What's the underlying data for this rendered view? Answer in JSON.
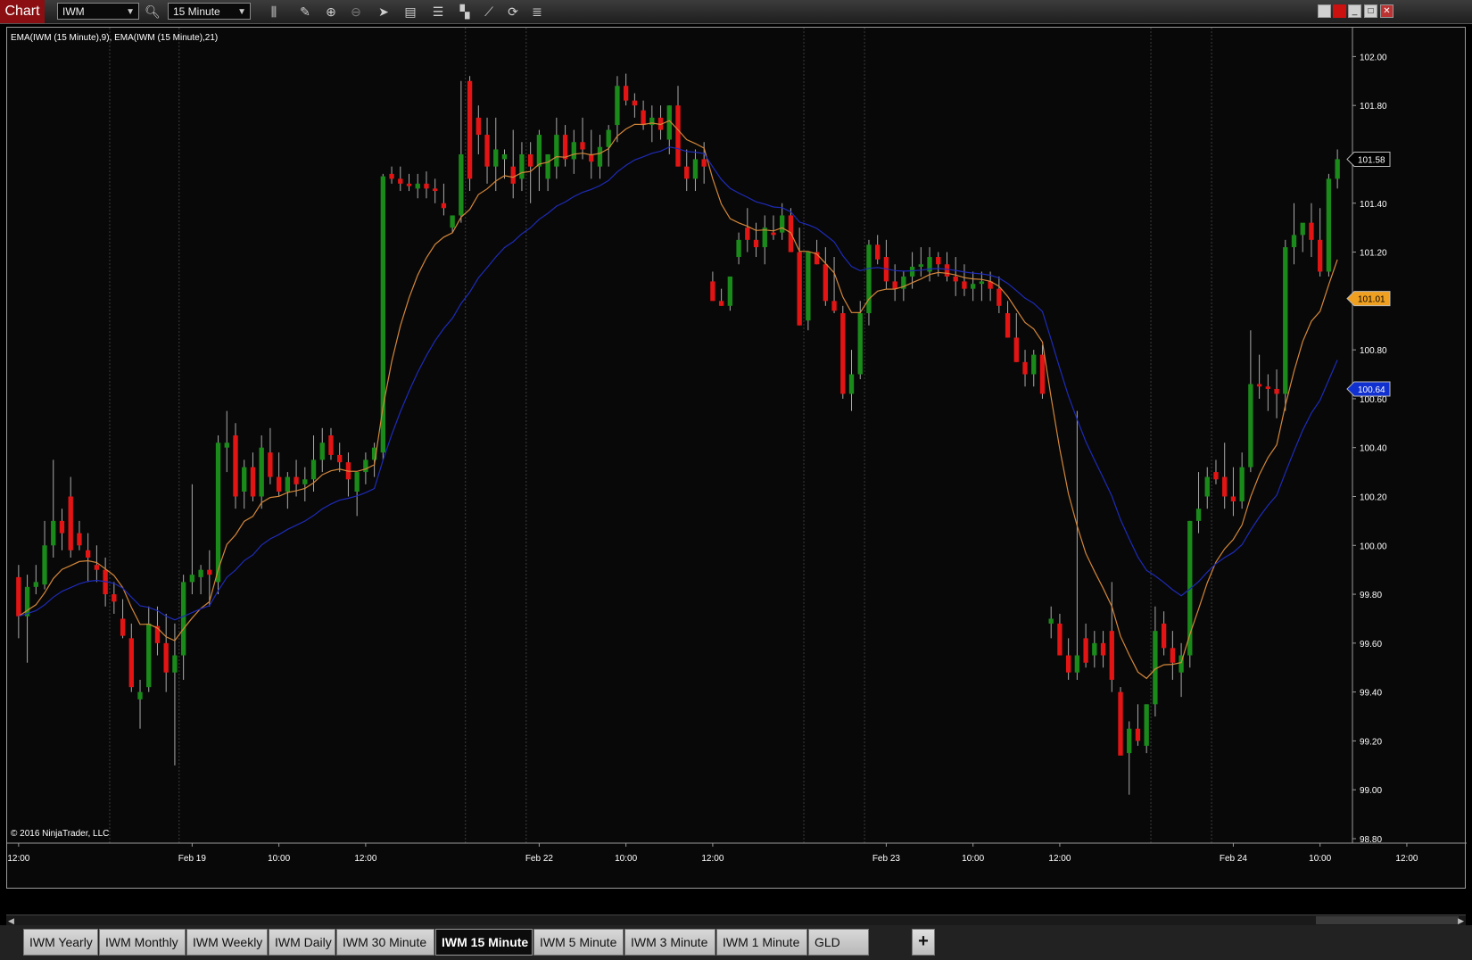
{
  "app": {
    "label": "Chart"
  },
  "toolbar": {
    "instrument": "IWM",
    "interval": "15 Minute",
    "icons": [
      "search-icon",
      "bar-type-icon",
      "pencil-icon",
      "zoom-in-icon",
      "zoom-out-icon",
      "cursor-icon",
      "data-box-icon",
      "chart-style-icon",
      "arrange-icon",
      "drawing-tools-icon",
      "refresh-icon",
      "properties-icon"
    ]
  },
  "window_controls": [
    "minimize",
    "maximize",
    "close"
  ],
  "indicator_label": "EMA(IWM (15 Minute),9), EMA(IWM (15 Minute),21)",
  "copyright": "© 2016 NinjaTrader, LLC",
  "tabs": [
    "IWM Yearly",
    "IWM Monthly",
    "IWM Weekly",
    "IWM Daily",
    "IWM 30 Minute",
    "IWM 15 Minute",
    "IWM 5 Minute",
    "IWM 3 Minute",
    "IWM 1 Minute",
    "GLD"
  ],
  "active_tab": "IWM 15 Minute",
  "add_tab_label": "+",
  "colors": {
    "up": "#1a8a1a",
    "down": "#e31414",
    "ema_fast": "#d4873a",
    "ema_slow": "#1e2bb8",
    "background": "#080808"
  },
  "chart_data": {
    "type": "candlestick",
    "title": "",
    "xlabel": "",
    "ylabel": "",
    "ylim": [
      98.8,
      102.1
    ],
    "yticks": [
      "98.80",
      "99.00",
      "99.20",
      "99.40",
      "99.60",
      "99.80",
      "100.00",
      "100.20",
      "100.40",
      "100.60",
      "100.80",
      "101.00",
      "101.20",
      "101.40",
      "101.60",
      "101.80",
      "102.00"
    ],
    "xticks": [
      {
        "label": "12:00",
        "index": 0
      },
      {
        "label": "Feb 19",
        "index": 20
      },
      {
        "label": "10:00",
        "index": 30
      },
      {
        "label": "12:00",
        "index": 40
      },
      {
        "label": "Feb 22",
        "index": 60
      },
      {
        "label": "10:00",
        "index": 70
      },
      {
        "label": "12:00",
        "index": 80
      },
      {
        "label": "Feb 23",
        "index": 100
      },
      {
        "label": "10:00",
        "index": 110
      },
      {
        "label": "12:00",
        "index": 120
      },
      {
        "label": "Feb 24",
        "index": 140
      },
      {
        "label": "10:00",
        "index": 150
      },
      {
        "label": "12:00",
        "index": 160
      }
    ],
    "session_breaks": [
      11,
      19,
      52,
      59,
      91,
      98,
      131,
      138
    ],
    "price_markers": [
      {
        "value": "101.58",
        "price": 101.58,
        "color": "#ffffff",
        "bg": "#000000"
      },
      {
        "value": "101.01",
        "price": 101.01,
        "color": "#000000",
        "bg": "#f0a020"
      },
      {
        "value": "100.64",
        "price": 100.64,
        "color": "#ffffff",
        "bg": "#1030d0"
      }
    ],
    "ohlc": [
      [
        99.87,
        99.92,
        99.62,
        99.71
      ],
      [
        99.71,
        99.88,
        99.52,
        99.83
      ],
      [
        99.83,
        99.92,
        99.8,
        99.85
      ],
      [
        99.84,
        100.1,
        99.82,
        100.0
      ],
      [
        100.0,
        100.35,
        99.95,
        100.1
      ],
      [
        100.1,
        100.15,
        99.98,
        100.05
      ],
      [
        100.2,
        100.28,
        99.95,
        99.98
      ],
      [
        100.05,
        100.1,
        99.98,
        100.0
      ],
      [
        99.98,
        100.05,
        99.85,
        99.95
      ],
      [
        99.92,
        100.0,
        99.85,
        99.9
      ],
      [
        99.9,
        99.95,
        99.75,
        99.8
      ],
      [
        99.8,
        99.85,
        99.72,
        99.77
      ],
      [
        99.7,
        99.78,
        99.62,
        99.63
      ],
      [
        99.62,
        99.68,
        99.4,
        99.42
      ],
      [
        99.37,
        99.45,
        99.25,
        99.4
      ],
      [
        99.42,
        99.75,
        99.4,
        99.68
      ],
      [
        99.67,
        99.75,
        99.55,
        99.6
      ],
      [
        99.6,
        99.72,
        99.4,
        99.48
      ],
      [
        99.48,
        99.68,
        99.1,
        99.55
      ],
      [
        99.55,
        99.88,
        99.45,
        99.85
      ],
      [
        99.85,
        100.25,
        99.8,
        99.88
      ],
      [
        99.87,
        99.92,
        99.8,
        99.9
      ],
      [
        99.9,
        99.98,
        99.75,
        99.88
      ],
      [
        99.85,
        100.45,
        99.8,
        100.42
      ],
      [
        100.4,
        100.55,
        100.3,
        100.42
      ],
      [
        100.45,
        100.5,
        100.15,
        100.2
      ],
      [
        100.22,
        100.35,
        100.15,
        100.32
      ],
      [
        100.32,
        100.38,
        100.18,
        100.2
      ],
      [
        100.2,
        100.45,
        100.15,
        100.4
      ],
      [
        100.38,
        100.48,
        100.25,
        100.28
      ],
      [
        100.28,
        100.38,
        100.2,
        100.22
      ],
      [
        100.22,
        100.3,
        100.15,
        100.28
      ],
      [
        100.28,
        100.35,
        100.2,
        100.25
      ],
      [
        100.25,
        100.32,
        100.18,
        100.27
      ],
      [
        100.27,
        100.45,
        100.22,
        100.35
      ],
      [
        100.35,
        100.48,
        100.3,
        100.42
      ],
      [
        100.45,
        100.48,
        100.35,
        100.37
      ],
      [
        100.37,
        100.42,
        100.3,
        100.34
      ],
      [
        100.34,
        100.38,
        100.2,
        100.27
      ],
      [
        100.22,
        100.3,
        100.12,
        100.3
      ],
      [
        100.3,
        100.38,
        100.25,
        100.35
      ],
      [
        100.35,
        100.42,
        100.28,
        100.4
      ],
      [
        100.38,
        101.52,
        100.35,
        101.51
      ],
      [
        101.52,
        101.55,
        101.48,
        101.5
      ],
      [
        101.5,
        101.55,
        101.45,
        101.48
      ],
      [
        101.48,
        101.52,
        101.45,
        101.47
      ],
      [
        101.46,
        101.52,
        101.42,
        101.48
      ],
      [
        101.48,
        101.53,
        101.42,
        101.46
      ],
      [
        101.46,
        101.5,
        101.4,
        101.45
      ],
      [
        101.4,
        101.48,
        101.35,
        101.38
      ],
      [
        101.3,
        101.35,
        101.28,
        101.35
      ],
      [
        101.35,
        101.9,
        101.32,
        101.6
      ],
      [
        101.9,
        101.92,
        101.45,
        101.5
      ],
      [
        101.75,
        101.8,
        101.6,
        101.68
      ],
      [
        101.68,
        101.75,
        101.48,
        101.55
      ],
      [
        101.55,
        101.75,
        101.45,
        101.62
      ],
      [
        101.58,
        101.62,
        101.5,
        101.6
      ],
      [
        101.55,
        101.7,
        101.42,
        101.48
      ],
      [
        101.5,
        101.65,
        101.45,
        101.6
      ],
      [
        101.6,
        101.65,
        101.4,
        101.55
      ],
      [
        101.55,
        101.7,
        101.45,
        101.68
      ],
      [
        101.5,
        101.6,
        101.45,
        101.6
      ],
      [
        101.55,
        101.75,
        101.5,
        101.68
      ],
      [
        101.68,
        101.72,
        101.55,
        101.58
      ],
      [
        101.58,
        101.7,
        101.52,
        101.65
      ],
      [
        101.65,
        101.75,
        101.58,
        101.62
      ],
      [
        101.6,
        101.7,
        101.5,
        101.57
      ],
      [
        101.55,
        101.68,
        101.5,
        101.63
      ],
      [
        101.63,
        101.72,
        101.55,
        101.7
      ],
      [
        101.72,
        101.92,
        101.65,
        101.88
      ],
      [
        101.88,
        101.93,
        101.8,
        101.82
      ],
      [
        101.82,
        101.85,
        101.75,
        101.8
      ],
      [
        101.78,
        101.82,
        101.7,
        101.72
      ],
      [
        101.72,
        101.8,
        101.65,
        101.75
      ],
      [
        101.75,
        101.8,
        101.66,
        101.7
      ],
      [
        101.66,
        101.8,
        101.6,
        101.8
      ],
      [
        101.8,
        101.88,
        101.55,
        101.55
      ],
      [
        101.55,
        101.62,
        101.45,
        101.5
      ],
      [
        101.5,
        101.62,
        101.45,
        101.58
      ],
      [
        101.58,
        101.65,
        101.48,
        101.55
      ],
      [
        101.08,
        101.12,
        101.02,
        101.0
      ],
      [
        101.0,
        101.05,
        100.98,
        100.98
      ],
      [
        100.98,
        101.1,
        100.96,
        101.1
      ],
      [
        101.18,
        101.28,
        101.15,
        101.25
      ],
      [
        101.3,
        101.38,
        101.2,
        101.25
      ],
      [
        101.25,
        101.32,
        101.18,
        101.22
      ],
      [
        101.22,
        101.35,
        101.15,
        101.3
      ],
      [
        101.28,
        101.35,
        101.25,
        101.27
      ],
      [
        101.28,
        101.4,
        101.25,
        101.35
      ],
      [
        101.35,
        101.38,
        101.2,
        101.2
      ],
      [
        101.2,
        101.3,
        100.9,
        100.9
      ],
      [
        100.92,
        101.2,
        100.88,
        101.2
      ],
      [
        101.2,
        101.25,
        101.15,
        101.15
      ],
      [
        101.15,
        101.22,
        100.98,
        101.0
      ],
      [
        101.0,
        101.18,
        100.95,
        100.96
      ],
      [
        100.95,
        100.98,
        100.6,
        100.62
      ],
      [
        100.62,
        100.8,
        100.55,
        100.7
      ],
      [
        100.7,
        101.0,
        100.68,
        100.95
      ],
      [
        100.95,
        101.25,
        100.9,
        101.23
      ],
      [
        101.23,
        101.27,
        101.15,
        101.17
      ],
      [
        101.18,
        101.25,
        101.05,
        101.08
      ],
      [
        101.08,
        101.15,
        101.0,
        101.05
      ],
      [
        101.05,
        101.12,
        101.0,
        101.1
      ],
      [
        101.1,
        101.2,
        101.05,
        101.14
      ],
      [
        101.14,
        101.22,
        101.1,
        101.15
      ],
      [
        101.12,
        101.22,
        101.08,
        101.18
      ],
      [
        101.18,
        101.2,
        101.1,
        101.15
      ],
      [
        101.15,
        101.2,
        101.08,
        101.1
      ],
      [
        101.1,
        101.18,
        101.02,
        101.08
      ],
      [
        101.08,
        101.15,
        101.02,
        101.05
      ],
      [
        101.05,
        101.12,
        101.0,
        101.07
      ],
      [
        101.07,
        101.12,
        101.0,
        101.08
      ],
      [
        101.08,
        101.12,
        101.0,
        101.05
      ],
      [
        101.05,
        101.1,
        100.95,
        100.98
      ],
      [
        100.95,
        101.0,
        100.85,
        100.85
      ],
      [
        100.85,
        100.95,
        100.75,
        100.75
      ],
      [
        100.75,
        100.8,
        100.65,
        100.7
      ],
      [
        100.7,
        100.8,
        100.65,
        100.78
      ],
      [
        100.78,
        100.82,
        100.6,
        100.62
      ],
      [
        99.68,
        99.75,
        99.62,
        99.7
      ],
      [
        99.68,
        99.72,
        99.55,
        99.55
      ],
      [
        99.55,
        99.62,
        99.45,
        99.48
      ],
      [
        99.48,
        100.55,
        99.45,
        99.55
      ],
      [
        99.62,
        99.68,
        99.5,
        99.52
      ],
      [
        99.55,
        99.65,
        99.5,
        99.6
      ],
      [
        99.6,
        99.65,
        99.5,
        99.55
      ],
      [
        99.65,
        99.85,
        99.4,
        99.45
      ],
      [
        99.4,
        99.42,
        99.15,
        99.14
      ],
      [
        99.15,
        99.28,
        98.98,
        99.25
      ],
      [
        99.25,
        99.35,
        99.18,
        99.2
      ],
      [
        99.18,
        99.35,
        99.15,
        99.35
      ],
      [
        99.35,
        99.75,
        99.3,
        99.65
      ],
      [
        99.68,
        99.73,
        99.55,
        99.58
      ],
      [
        99.58,
        99.65,
        99.45,
        99.52
      ],
      [
        99.48,
        99.6,
        99.38,
        99.55
      ],
      [
        99.55,
        100.1,
        99.5,
        100.1
      ],
      [
        100.1,
        100.3,
        100.05,
        100.15
      ],
      [
        100.2,
        100.32,
        100.15,
        100.28
      ],
      [
        100.3,
        100.35,
        100.25,
        100.27
      ],
      [
        100.28,
        100.42,
        100.15,
        100.2
      ],
      [
        100.2,
        100.32,
        100.12,
        100.18
      ],
      [
        100.18,
        100.38,
        100.15,
        100.32
      ],
      [
        100.32,
        100.88,
        100.3,
        100.66
      ],
      [
        100.66,
        100.78,
        100.6,
        100.65
      ],
      [
        100.65,
        100.7,
        100.55,
        100.64
      ],
      [
        100.64,
        100.72,
        100.52,
        100.62
      ],
      [
        100.62,
        101.25,
        100.55,
        101.22
      ],
      [
        101.22,
        101.4,
        101.15,
        101.27
      ],
      [
        101.27,
        101.3,
        101.2,
        101.32
      ],
      [
        101.32,
        101.4,
        101.18,
        101.25
      ],
      [
        101.25,
        101.38,
        101.1,
        101.12
      ],
      [
        101.12,
        101.52,
        101.1,
        101.5
      ],
      [
        101.5,
        101.62,
        101.46,
        101.58
      ]
    ],
    "series": [
      {
        "name": "EMA(IWM (15 Minute),9)",
        "role": "ema_fast"
      },
      {
        "name": "EMA(IWM (15 Minute),21)",
        "role": "ema_slow"
      }
    ]
  }
}
